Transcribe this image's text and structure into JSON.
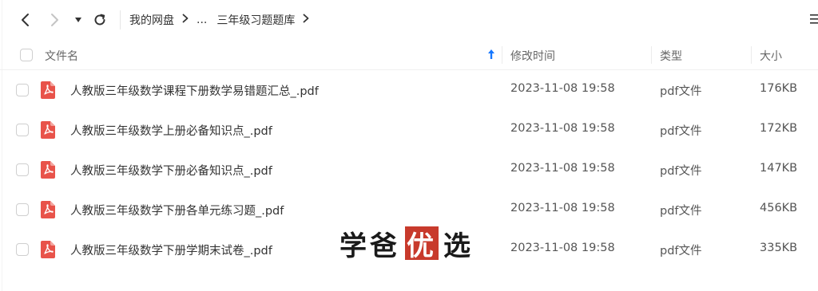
{
  "toolbar": {
    "back_icon": "chevron-left-icon",
    "forward_icon": "chevron-right-icon",
    "history_icon": "caret-down-icon",
    "refresh_icon": "refresh-icon",
    "menu_icon": "list-menu-icon",
    "breadcrumb": [
      "我的网盘",
      "...",
      "三年级习题题库"
    ]
  },
  "header": {
    "name": "文件名",
    "modified": "修改时间",
    "type": "类型",
    "size": "大小",
    "sort_icon": "sort-arrow-up-icon"
  },
  "files": [
    {
      "name": "人教版三年级数学课程下册数学易错题汇总_.pdf",
      "modified": "2023-11-08 19:58",
      "type": "pdf文件",
      "size": "176KB"
    },
    {
      "name": "人教版三年级数学上册必备知识点_.pdf",
      "modified": "2023-11-08 19:58",
      "type": "pdf文件",
      "size": "172KB"
    },
    {
      "name": "人教版三年级数学下册必备知识点_.pdf",
      "modified": "2023-11-08 19:58",
      "type": "pdf文件",
      "size": "147KB"
    },
    {
      "name": "人教版三年级数学下册各单元练习题_.pdf",
      "modified": "2023-11-08 19:58",
      "type": "pdf文件",
      "size": "456KB"
    },
    {
      "name": "人教版三年级数学下册学期末试卷_.pdf",
      "modified": "2023-11-08 19:58",
      "type": "pdf文件",
      "size": "335KB"
    }
  ],
  "watermark": {
    "part1": "学爸",
    "part2": "优",
    "part3": "选"
  },
  "colors": {
    "accent": "#1677ff",
    "pdf_red": "#e8534a",
    "watermark_red": "#c83a2c"
  }
}
